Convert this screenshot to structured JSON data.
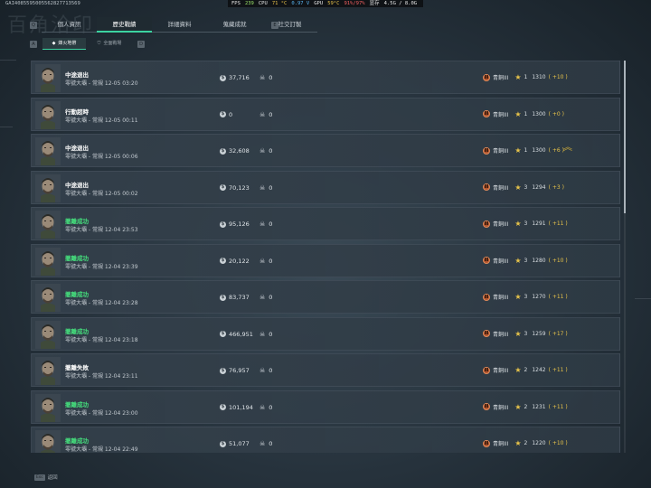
{
  "overlay": {
    "uid": "GAI4085595005562827713569",
    "fps_label": "FPS",
    "fps": "239",
    "cpu_label": "CPU",
    "cpu_temp": "71 °C",
    "cpu_volt": "0.97 V",
    "gpu_label": "GPU",
    "gpu_temp": "59°C",
    "gpu_load": "91%/97%",
    "vram_label": "显存",
    "vram": "4.5G / 8.0G"
  },
  "watermark": "百角洽印",
  "keys": {
    "q": "Q",
    "e": "E",
    "a": "A",
    "d": "D"
  },
  "tabs": [
    {
      "label": "個人資訊",
      "active": false
    },
    {
      "label": "歷史戰績",
      "active": true
    },
    {
      "label": "詳細資料",
      "active": false
    },
    {
      "label": "蒐藏成就",
      "active": false
    },
    {
      "label": "社交訂製",
      "active": false
    }
  ],
  "subtabs": [
    {
      "label": "烽火地帶",
      "icon": "fire-icon",
      "active": true
    },
    {
      "label": "全面戰場",
      "icon": "shield-icon",
      "active": false
    }
  ],
  "records": [
    {
      "status": "中途退出",
      "success": false,
      "mode": "零號大壩 - 常規 12-05 03:20",
      "money": "37,716",
      "kills": "0",
      "rank_name": "青銅III",
      "stars": "1",
      "score": "1310",
      "delta": "( +10 )",
      "chevron": false
    },
    {
      "status": "行動超時",
      "success": false,
      "mode": "零號大壩 - 常規 12-05 00:11",
      "money": "0",
      "kills": "0",
      "rank_name": "青銅III",
      "stars": "1",
      "score": "1300",
      "delta": "( +0 )",
      "chevron": false
    },
    {
      "status": "中途退出",
      "success": false,
      "mode": "零號大壩 - 常規 12-05 00:06",
      "money": "32,608",
      "kills": "0",
      "rank_name": "青銅III",
      "stars": "1",
      "score": "1300",
      "delta": "( +6 )",
      "chevron": true
    },
    {
      "status": "中途退出",
      "success": false,
      "mode": "零號大壩 - 常規 12-05 00:02",
      "money": "70,123",
      "kills": "0",
      "rank_name": "青銅III",
      "stars": "3",
      "score": "1294",
      "delta": "( +3 )",
      "chevron": false
    },
    {
      "status": "撤離成功",
      "success": true,
      "mode": "零號大壩 - 常規 12-04 23:53",
      "money": "95,126",
      "kills": "0",
      "rank_name": "青銅III",
      "stars": "3",
      "score": "1291",
      "delta": "( +11 )",
      "chevron": false
    },
    {
      "status": "撤離成功",
      "success": true,
      "mode": "零號大壩 - 常規 12-04 23:39",
      "money": "20,122",
      "kills": "0",
      "rank_name": "青銅III",
      "stars": "3",
      "score": "1280",
      "delta": "( +10 )",
      "chevron": false
    },
    {
      "status": "撤離成功",
      "success": true,
      "mode": "零號大壩 - 常規 12-04 23:28",
      "money": "83,737",
      "kills": "0",
      "rank_name": "青銅III",
      "stars": "3",
      "score": "1270",
      "delta": "( +11 )",
      "chevron": false
    },
    {
      "status": "撤離成功",
      "success": true,
      "mode": "零號大壩 - 常規 12-04 23:18",
      "money": "466,951",
      "kills": "0",
      "rank_name": "青銅III",
      "stars": "3",
      "score": "1259",
      "delta": "( +17 )",
      "chevron": false
    },
    {
      "status": "撤離失敗",
      "success": false,
      "mode": "零號大壩 - 常規 12-04 23:11",
      "money": "76,957",
      "kills": "0",
      "rank_name": "青銅III",
      "stars": "2",
      "score": "1242",
      "delta": "( +11 )",
      "chevron": false
    },
    {
      "status": "撤離成功",
      "success": true,
      "mode": "零號大壩 - 常規 12-04 23:00",
      "money": "101,194",
      "kills": "0",
      "rank_name": "青銅III",
      "stars": "2",
      "score": "1231",
      "delta": "( +11 )",
      "chevron": false
    },
    {
      "status": "撤離成功",
      "success": true,
      "mode": "零號大壩 - 常規 12-04 22:49",
      "money": "51,077",
      "kills": "0",
      "rank_name": "青銅III",
      "stars": "2",
      "score": "1220",
      "delta": "( +10 )",
      "chevron": false
    }
  ],
  "scroll": {
    "thumb_fraction": 0.39
  },
  "footer": {
    "key": "Esc",
    "label": "返回"
  },
  "colors": {
    "accent": "#3cd3a0",
    "success": "#45e07d",
    "gold": "#e7c34a",
    "bronze": "#b2552e"
  }
}
